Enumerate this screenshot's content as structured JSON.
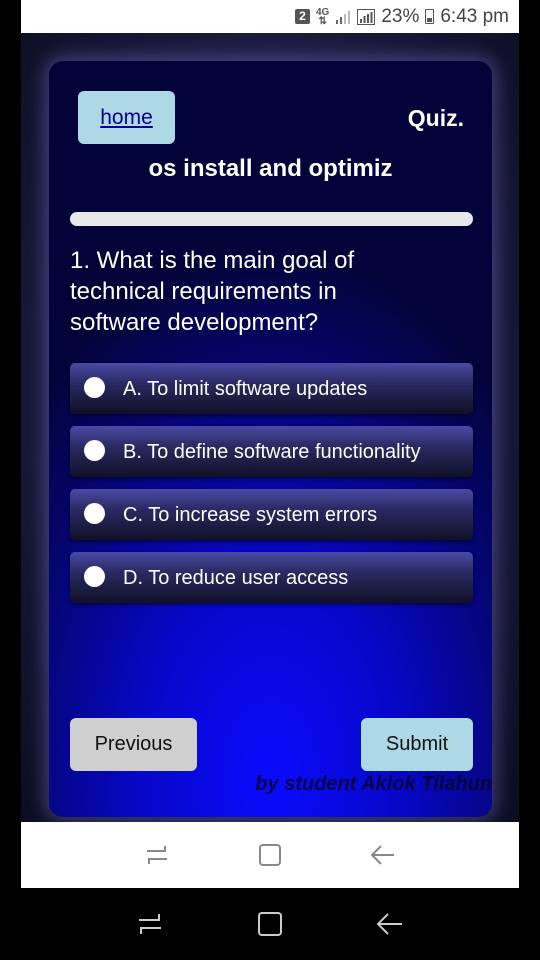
{
  "status_bar": {
    "sim_badge": "2",
    "network_type": "4G",
    "battery_percent": "23%",
    "time": "6:43 pm"
  },
  "header": {
    "home_link": "home",
    "quiz_label": "Quiz.",
    "subject": "os install and optimiz"
  },
  "progress": {
    "fraction": 0.0
  },
  "question": {
    "text": "1. What is the main goal of technical requirements in software development?"
  },
  "options": [
    {
      "label": "A. To limit software updates"
    },
    {
      "label": "B. To define software functionality"
    },
    {
      "label": "C. To increase system errors"
    },
    {
      "label": "D. To reduce user access"
    }
  ],
  "footer": {
    "previous_label": "Previous",
    "submit_label": "Submit",
    "credit": "by student Aklok Tilahun"
  },
  "icons": {
    "recent_apps": "recent-apps-icon",
    "home": "home-icon",
    "back": "back-icon"
  },
  "colors": {
    "home_button": "#add8e6",
    "submit_button": "#add8e6",
    "previous_button": "#cfcfcf",
    "card_blue": "#0707c7"
  }
}
